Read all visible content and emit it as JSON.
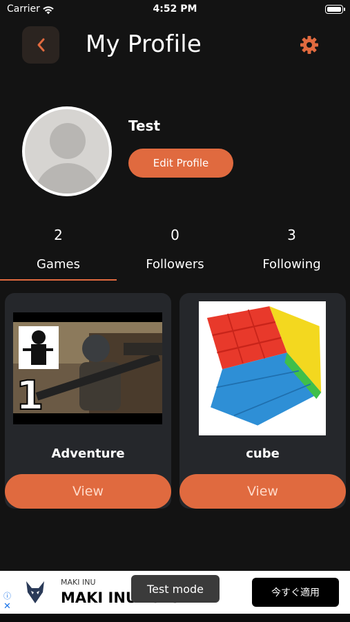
{
  "status_bar": {
    "carrier": "Carrier",
    "time": "4:52 PM"
  },
  "header": {
    "title": "My Profile",
    "back_icon": "chevron-left-icon",
    "settings_icon": "gear-icon"
  },
  "profile": {
    "username": "Test",
    "edit_label": "Edit Profile"
  },
  "stats": [
    {
      "count": "2",
      "label": "Games"
    },
    {
      "count": "0",
      "label": "Followers"
    },
    {
      "count": "3",
      "label": "Following"
    }
  ],
  "games": [
    {
      "name": "Adventure",
      "view_label": "View"
    },
    {
      "name": "cube",
      "view_label": "View"
    }
  ],
  "ad": {
    "brand_small": "MAKI INU",
    "brand_big": "MAKI INU Token",
    "cta": "今すぐ適用",
    "test_mode": "Test mode"
  },
  "colors": {
    "accent": "#e06a3f",
    "background": "#131313",
    "card": "#25272b"
  }
}
